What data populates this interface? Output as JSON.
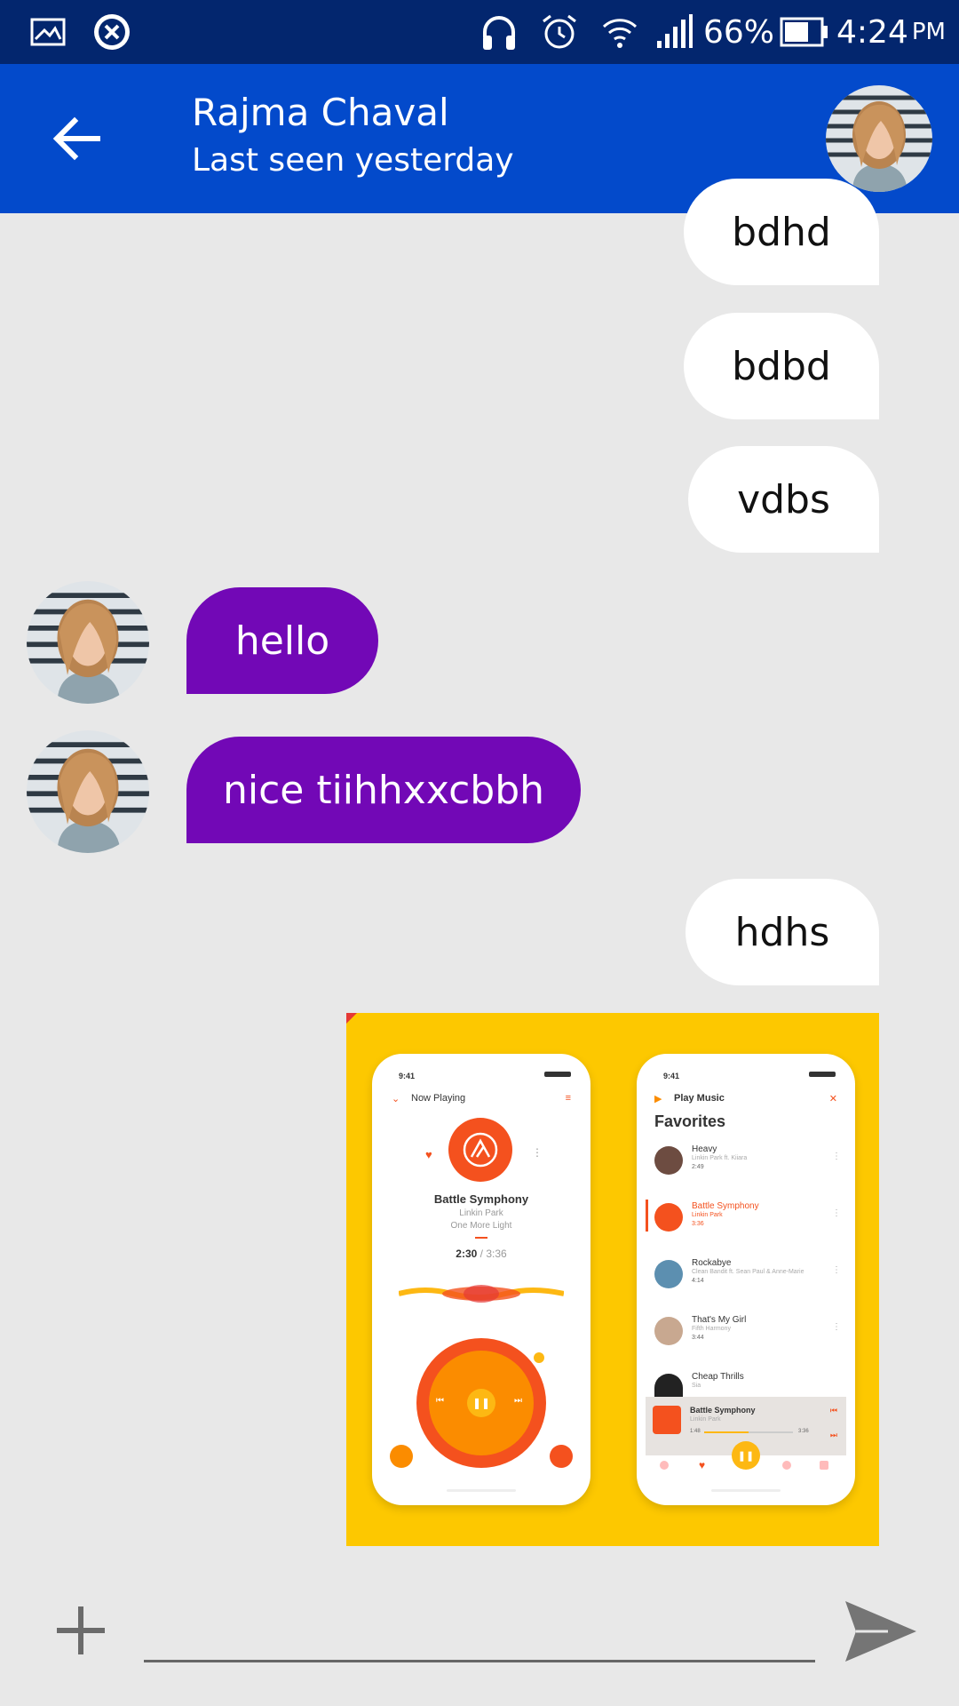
{
  "status_bar": {
    "battery_percent": "66%",
    "time": "4:24",
    "ampm": "PM"
  },
  "header": {
    "contact_name": "Rajma Chaval",
    "last_seen": "Last seen yesterday"
  },
  "messages": [
    {
      "direction": "outgoing",
      "text": "bdhd"
    },
    {
      "direction": "outgoing",
      "text": "bdbd"
    },
    {
      "direction": "outgoing",
      "text": "vdbs"
    },
    {
      "direction": "incoming",
      "text": "hello"
    },
    {
      "direction": "incoming",
      "text": "nice tiihhxxcbbh"
    },
    {
      "direction": "outgoing",
      "text": "hdhs"
    }
  ],
  "image_message": {
    "left_phone": {
      "time": "9:41",
      "header": "Now Playing",
      "song": "Battle Symphony",
      "artist": "Linkin Park",
      "album": "One More Light",
      "elapsed": "2:30",
      "total": "3:36"
    },
    "right_phone": {
      "time": "9:41",
      "app_name": "Play Music",
      "section": "Favorites",
      "tracks": [
        {
          "title": "Heavy",
          "artist": "Linkin Park ft. Kiiara",
          "duration": "2:49"
        },
        {
          "title": "Battle Symphony",
          "artist": "Linkin Park",
          "duration": "3:36"
        },
        {
          "title": "Rockabye",
          "artist": "Clean Bandit ft. Sean Paul & Anne-Marie",
          "duration": "4:14"
        },
        {
          "title": "That's My Girl",
          "artist": "Fifth Harmony",
          "duration": "3:44"
        },
        {
          "title": "Cheap Thrills",
          "artist": "Sia",
          "duration": ""
        }
      ],
      "mini_player": {
        "title": "Battle Symphony",
        "artist": "Linkin Park",
        "elapsed": "1:48",
        "total": "3:36"
      }
    }
  },
  "composer": {
    "placeholder": ""
  },
  "colors": {
    "status_bar": "#03266e",
    "app_bar": "#034acb",
    "incoming_bubble": "#7208b6",
    "outgoing_bubble": "#ffffff",
    "background": "#e8e8e8",
    "image_bg": "#fdc800",
    "accent": "#f4511e"
  }
}
